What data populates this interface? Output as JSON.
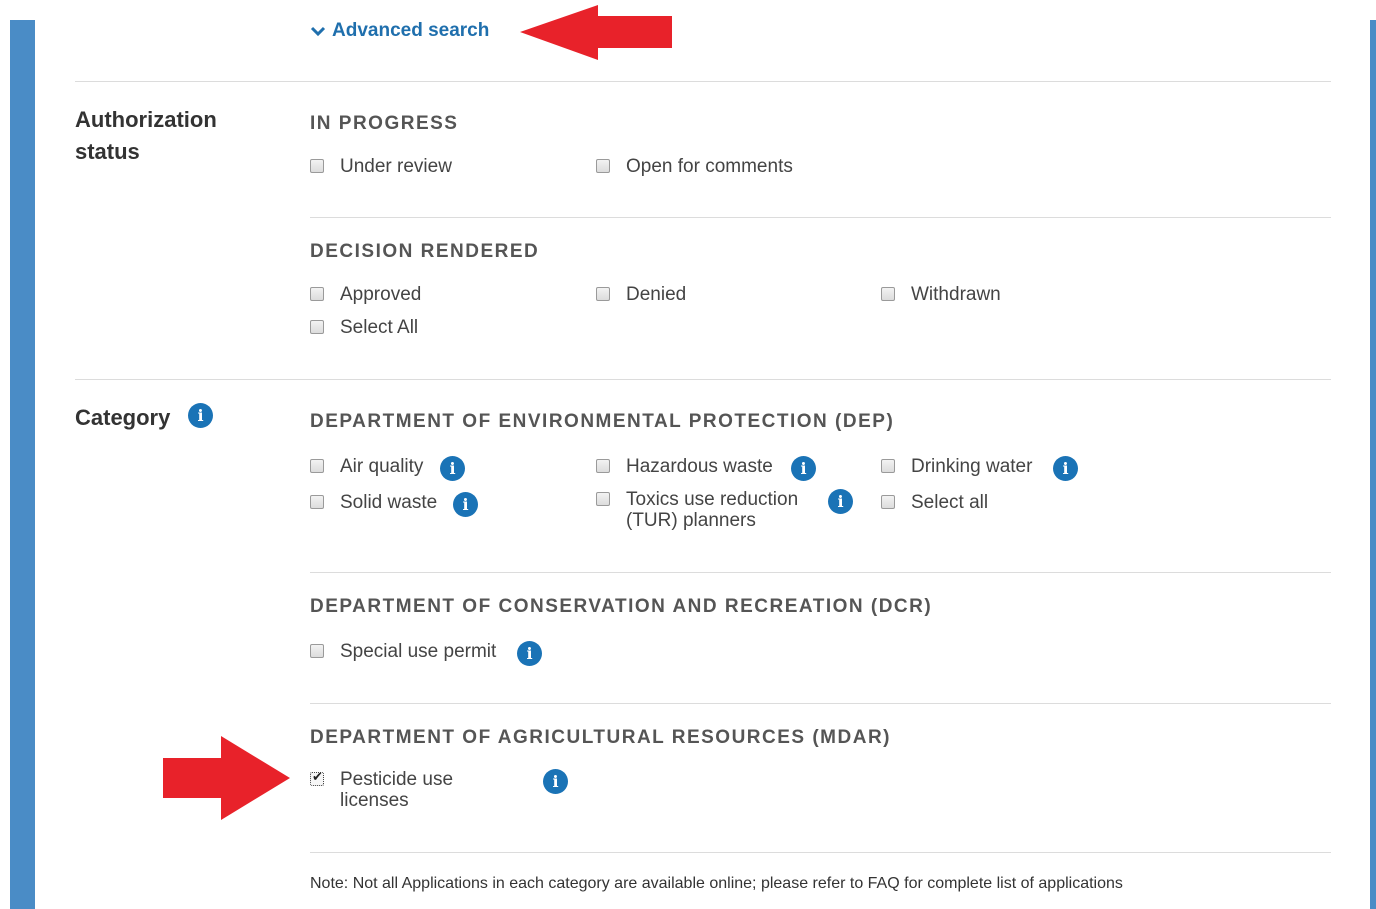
{
  "advanced_search": {
    "label": "Advanced search",
    "icon": "chevron-down-icon"
  },
  "authorization": {
    "label": "Authorization status",
    "in_progress": {
      "heading": "IN PROGRESS",
      "options": [
        {
          "label": "Under review",
          "checked": false
        },
        {
          "label": "Open for comments",
          "checked": false
        }
      ]
    },
    "decision": {
      "heading": "DECISION RENDERED",
      "options": [
        {
          "label": "Approved",
          "checked": false
        },
        {
          "label": "Denied",
          "checked": false
        },
        {
          "label": "Withdrawn",
          "checked": false
        },
        {
          "label": "Select All",
          "checked": false
        }
      ]
    }
  },
  "category": {
    "label": "Category",
    "dep": {
      "heading": "DEPARTMENT OF ENVIRONMENTAL PROTECTION (DEP)",
      "options": [
        {
          "label": "Air quality",
          "checked": false
        },
        {
          "label": "Hazardous waste",
          "checked": false
        },
        {
          "label": "Drinking water",
          "checked": false
        },
        {
          "label": "Solid waste",
          "checked": false
        },
        {
          "label": "Toxics use reduction (TUR) planners",
          "checked": false
        },
        {
          "label": "Select all",
          "checked": false
        }
      ]
    },
    "dcr": {
      "heading": "DEPARTMENT OF CONSERVATION AND RECREATION (DCR)",
      "options": [
        {
          "label": "Special use permit",
          "checked": false
        }
      ]
    },
    "mdar": {
      "heading": "DEPARTMENT OF AGRICULTURAL RESOURCES (MDAR)",
      "options": [
        {
          "label": "Pesticide use licenses",
          "checked": true
        }
      ]
    }
  },
  "note": "Note: Not all Applications in each category are available online; please refer to FAQ for complete list of applications",
  "colors": {
    "accent_blue": "#4a8cc6",
    "link_blue": "#1f6fad",
    "info_blue": "#1a73b6",
    "arrow_red": "#e8222a"
  },
  "info_icon_glyph": "i"
}
